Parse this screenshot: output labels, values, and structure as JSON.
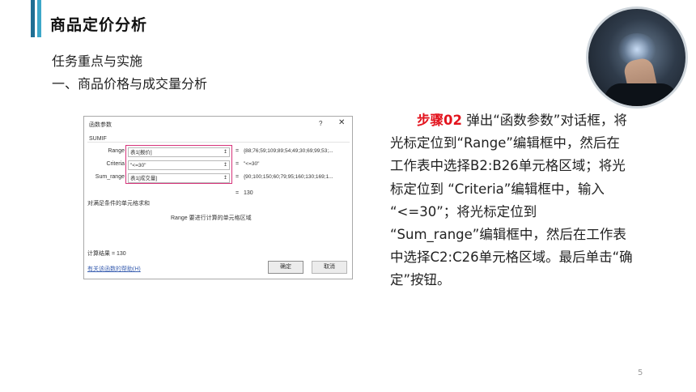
{
  "header": {
    "title": "商品定价分析",
    "accent_colors": [
      "#1f6f94",
      "#3da7c9"
    ]
  },
  "content": {
    "task_label": "任务重点与实施",
    "section_label": "一、商品价格与成交量分析"
  },
  "dialog": {
    "title": "函数参数",
    "help": "?",
    "close": "✕",
    "function_name": "SUMIF",
    "args": [
      {
        "label": "Range",
        "value": "表1[报价]",
        "icon": "↥",
        "equals": "=",
        "result": "{88;76;59;109;89;54;49;30;69;99;53;..."
      },
      {
        "label": "Criteria",
        "value": "\"<=30\"",
        "icon": "↥",
        "equals": "=",
        "result": "\"<=30\""
      },
      {
        "label": "Sum_range",
        "value": "表1[成交量]",
        "icon": "↥",
        "equals": "=",
        "result": "{90;100;150;60;79;95;160;130;169;1..."
      }
    ],
    "result_equals": "=",
    "result_value": "130",
    "description": "对满足条件的单元格求和",
    "arg_description": "Range   要进行计算的单元格区域",
    "calc_result": "计算结果 =    130",
    "help_link": "有关该函数的帮助(H)",
    "ok_label": "确定",
    "cancel_label": "取消",
    "highlight_color": "#d6337a"
  },
  "description": {
    "step_label": "步骤02",
    "text": "弹出“函数参数”对话框，将光标定位到“Range”编辑框中，然后在工作表中选择B2:B26单元格区域；将光标定位到 “Criteria”编辑框中，输入 “<=30”；将光标定位到 “Sum_range”编辑框中，然后在工作表中选择C2:C26单元格区域。最后单击“确定”按钮。",
    "step_color": "#e3141e"
  },
  "page_number": "5"
}
